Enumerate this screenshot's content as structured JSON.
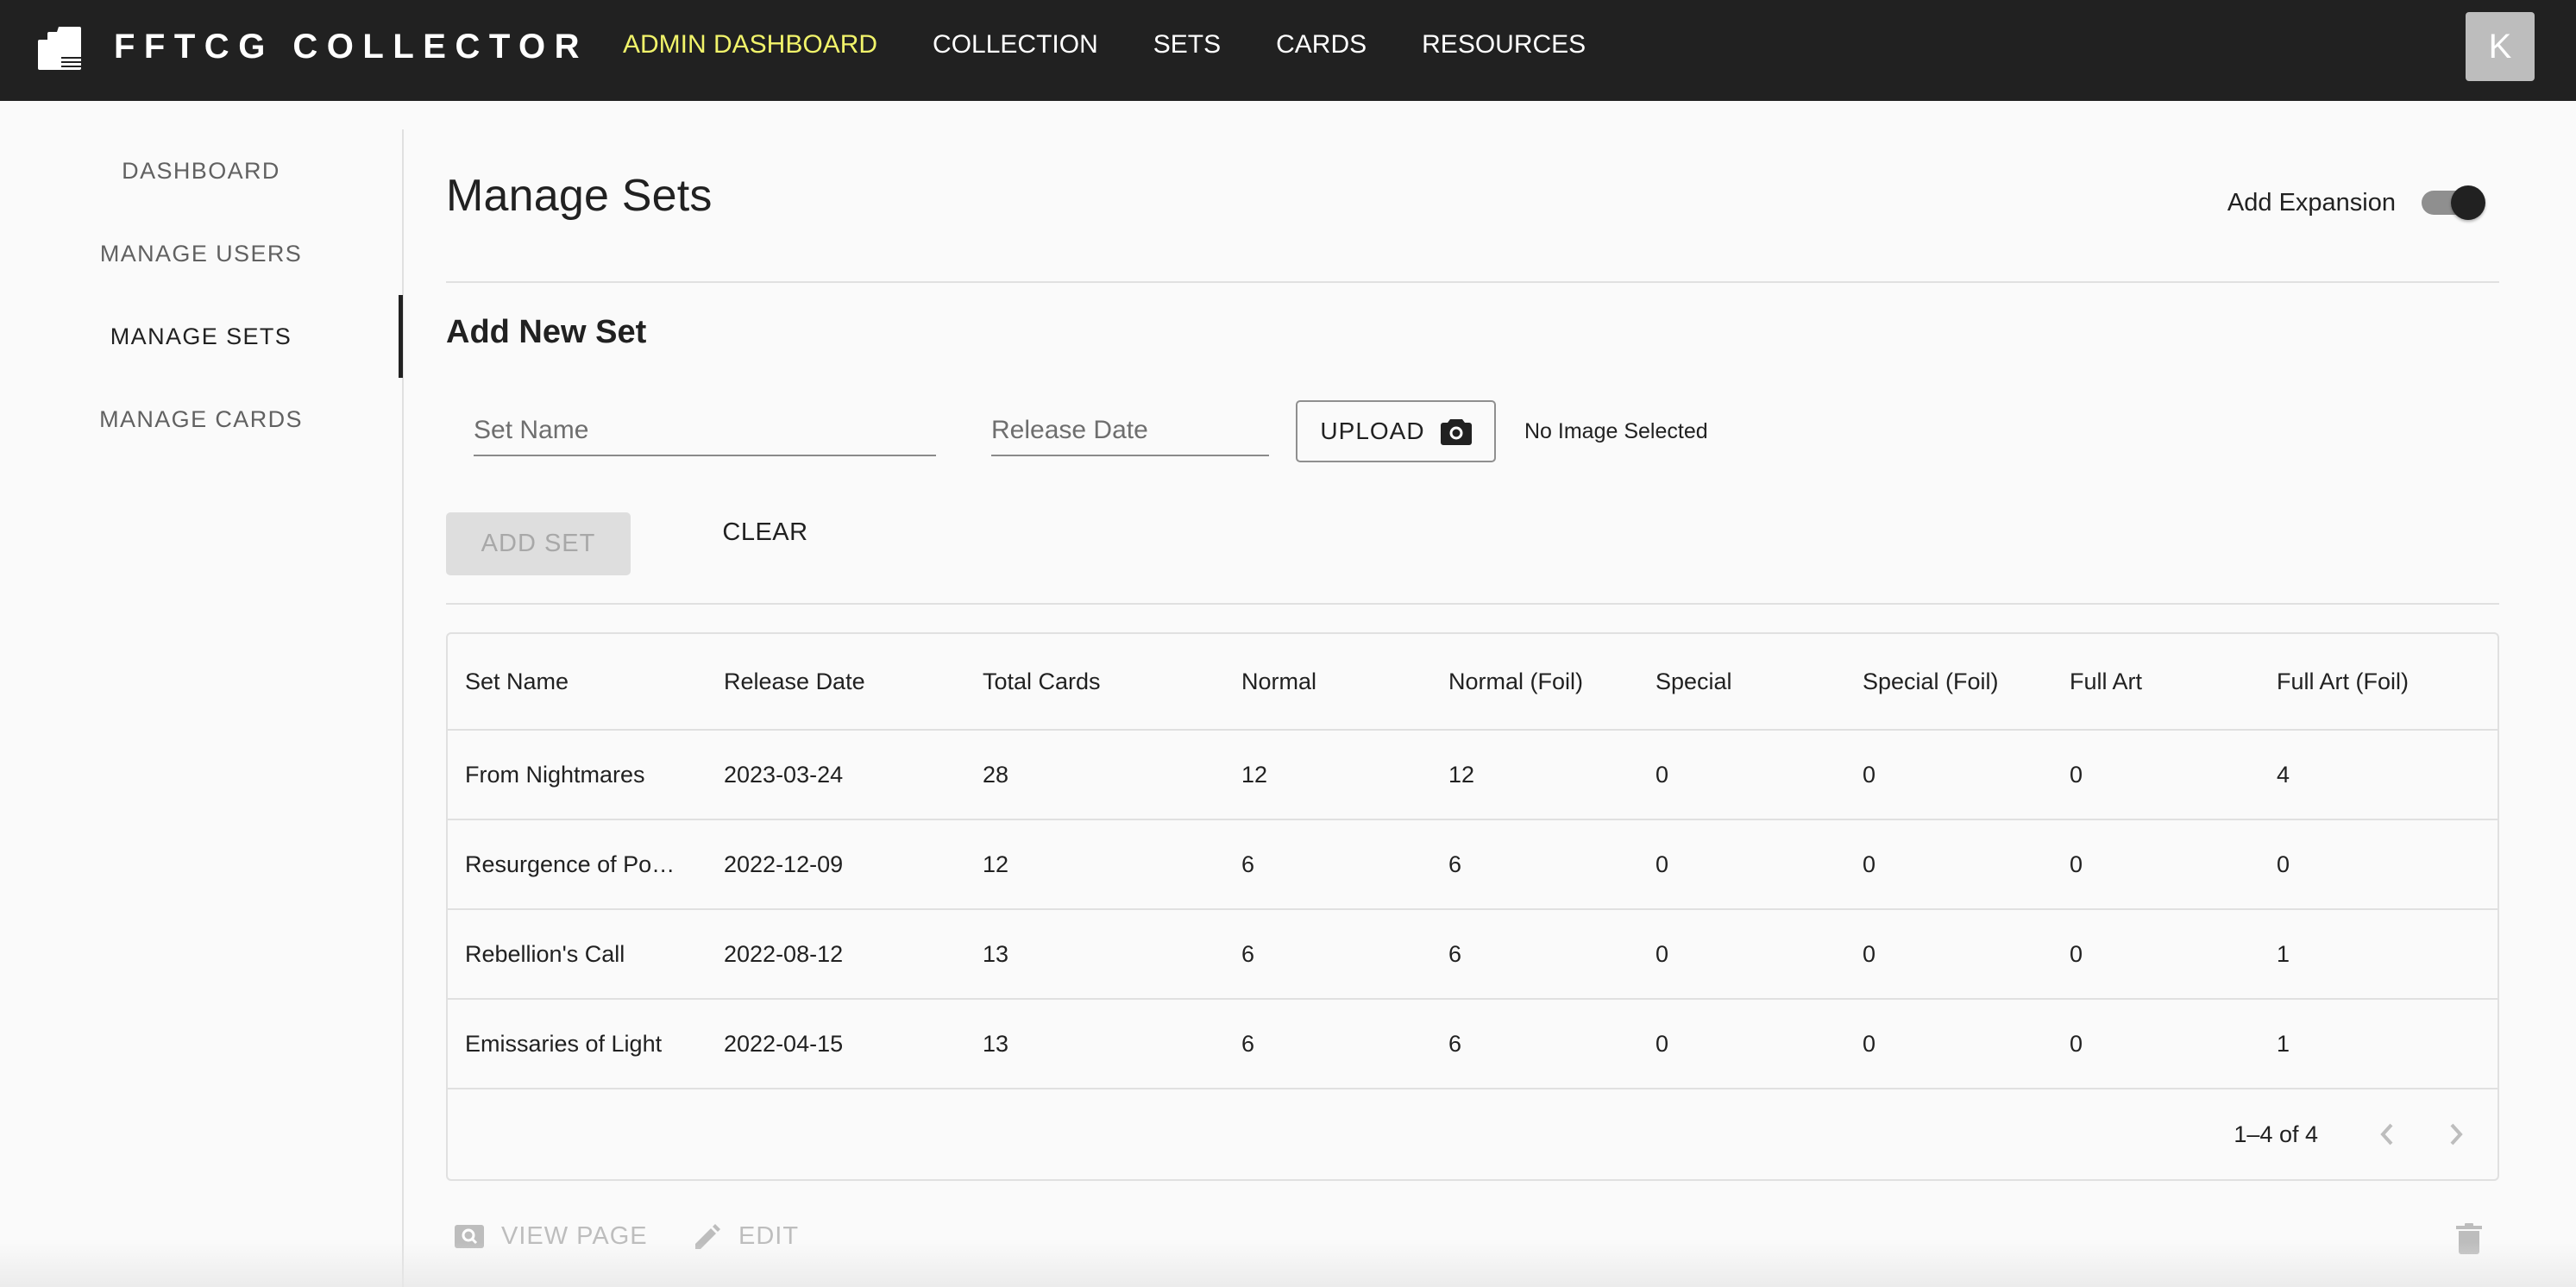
{
  "header": {
    "brand": "FFTCG COLLECTOR",
    "logo_icon": "card-stack-icon",
    "nav": [
      {
        "label": "ADMIN DASHBOARD",
        "active": true
      },
      {
        "label": "COLLECTION",
        "active": false
      },
      {
        "label": "SETS",
        "active": false
      },
      {
        "label": "CARDS",
        "active": false
      },
      {
        "label": "RESOURCES",
        "active": false
      }
    ],
    "avatar_initial": "K",
    "colors": {
      "bar": "#212121",
      "active_nav": "#f1f36a"
    }
  },
  "sidebar": {
    "items": [
      {
        "label": "DASHBOARD",
        "active": false
      },
      {
        "label": "MANAGE USERS",
        "active": false
      },
      {
        "label": "MANAGE SETS",
        "active": true
      },
      {
        "label": "MANAGE CARDS",
        "active": false
      }
    ]
  },
  "main": {
    "title": "Manage Sets",
    "expansion_toggle": {
      "label": "Add Expansion",
      "checked": true
    },
    "form": {
      "title": "Add New Set",
      "set_name": {
        "placeholder": "Set Name",
        "value": ""
      },
      "release_date": {
        "placeholder": "Release Date",
        "value": ""
      },
      "upload_label": "UPLOAD",
      "upload_icon": "camera-icon",
      "image_status": "No Image Selected",
      "add_label": "ADD SET",
      "clear_label": "CLEAR"
    },
    "table": {
      "columns": [
        "Set Name",
        "Release Date",
        "Total Cards",
        "Normal",
        "Normal (Foil)",
        "Special",
        "Special (Foil)",
        "Full Art",
        "Full Art (Foil)"
      ],
      "rows": [
        [
          "From Nightmares",
          "2023-03-24",
          "28",
          "12",
          "12",
          "0",
          "0",
          "0",
          "4"
        ],
        [
          "Resurgence of Po…",
          "2022-12-09",
          "12",
          "6",
          "6",
          "0",
          "0",
          "0",
          "0"
        ],
        [
          "Rebellion's Call",
          "2022-08-12",
          "13",
          "6",
          "6",
          "0",
          "0",
          "0",
          "1"
        ],
        [
          "Emissaries of Light",
          "2022-04-15",
          "13",
          "6",
          "6",
          "0",
          "0",
          "0",
          "1"
        ]
      ],
      "pagination": "1–4 of 4"
    },
    "actions": {
      "view_page": "VIEW PAGE",
      "edit": "EDIT"
    }
  }
}
